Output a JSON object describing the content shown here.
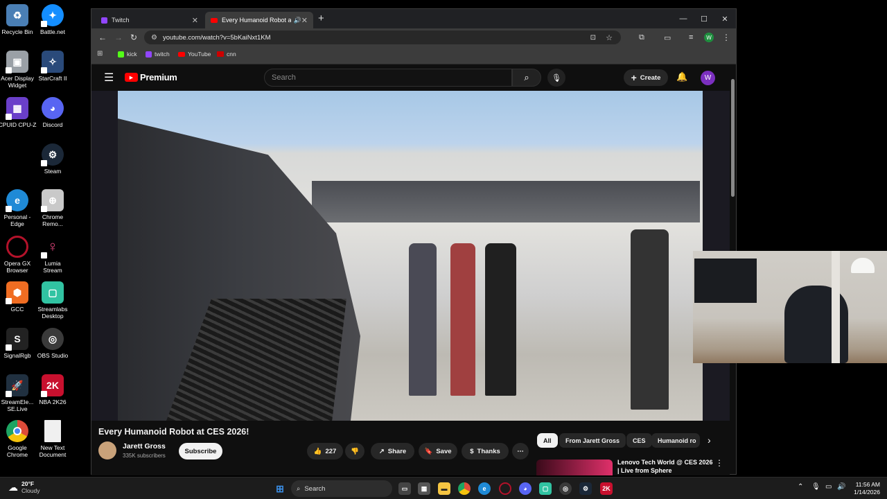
{
  "desktop_icons": [
    {
      "label": "Recycle Bin",
      "icon": "recycle-bin-icon",
      "color": "#4a7fb5"
    },
    {
      "label": "Battle.net",
      "icon": "battlenet-icon",
      "color": "#148eff"
    },
    {
      "label": "Acer Display Widget",
      "icon": "acer-display-widget-icon",
      "color": "#9aa0a6"
    },
    {
      "label": "StarCraft II",
      "icon": "starcraft-icon",
      "color": "#2a4a7a"
    },
    {
      "label": "CPUID CPU-Z",
      "icon": "cpuz-icon",
      "color": "#6a3fc9"
    },
    {
      "label": "Discord",
      "icon": "discord-icon",
      "color": "#5865f2"
    },
    {
      "label": "Steam",
      "icon": "steam-icon",
      "color": "#1b2838"
    },
    {
      "label": "Personal - Edge",
      "icon": "edge-icon",
      "color": "#1f8ad6"
    },
    {
      "label": "Chrome Remo...",
      "icon": "chrome-remote-icon",
      "color": "#c9c9c9"
    },
    {
      "label": "Opera GX Browser",
      "icon": "opera-gx-icon",
      "color": "#b3122a"
    },
    {
      "label": "Lumia Stream",
      "icon": "lumia-stream-icon",
      "color": "#e0457b"
    },
    {
      "label": "GCC",
      "icon": "gcc-icon",
      "color": "#f06d22"
    },
    {
      "label": "Streamlabs Desktop",
      "icon": "streamlabs-icon",
      "color": "#31c3a2"
    },
    {
      "label": "SignalRgb",
      "icon": "signalrgb-icon",
      "color": "#222"
    },
    {
      "label": "OBS Studio",
      "icon": "obs-icon",
      "color": "#3a3a3a"
    },
    {
      "label": "StreamEle... SE.Live",
      "icon": "streamelements-icon",
      "color": "#203040"
    },
    {
      "label": "NBA 2K26",
      "icon": "nba2k-icon",
      "color": "#c8102e"
    },
    {
      "label": "Google Chrome",
      "icon": "chrome-icon",
      "color": "#dd4b39"
    },
    {
      "label": "New Text Document",
      "icon": "text-document-icon",
      "color": "#f0f0f0"
    }
  ],
  "tabs": [
    {
      "title": "Twitch",
      "icon": "twitch-icon"
    },
    {
      "title": "Every Humanoid Robot at C",
      "icon": "youtube-icon"
    }
  ],
  "address": "youtube.com/watch?v=5bKaiNxt1KM",
  "profile_initial": "W",
  "bookmarks": [
    {
      "label": "kick",
      "color": "#53fc18"
    },
    {
      "label": "twitch",
      "color": "#9146ff"
    },
    {
      "label": "YouTube",
      "color": "#ff0000"
    },
    {
      "label": "cnn",
      "color": "#cc0000"
    }
  ],
  "youtube": {
    "logo_text": "Premium",
    "search_placeholder": "Search",
    "create_label": "Create",
    "avatar_initial": "W",
    "video_title": "Every Humanoid Robot at CES 2026!",
    "channel_name": "Jarett Gross",
    "subscribers": "335K subscribers",
    "subscribe_label": "Subscribe",
    "likes": "227",
    "share_label": "Share",
    "save_label": "Save",
    "thanks_label": "Thanks",
    "chips": [
      "All",
      "From Jarett Gross",
      "CES",
      "Humanoid ro"
    ],
    "rec_title_line1": "Lenovo Tech World @ CES 2026",
    "rec_title_line2": "| Live from Sphere"
  },
  "taskbar": {
    "weather_temp": "20°F",
    "weather_desc": "Cloudy",
    "search_label": "Search",
    "time": "11:56 AM",
    "date": "1/14/2026"
  }
}
